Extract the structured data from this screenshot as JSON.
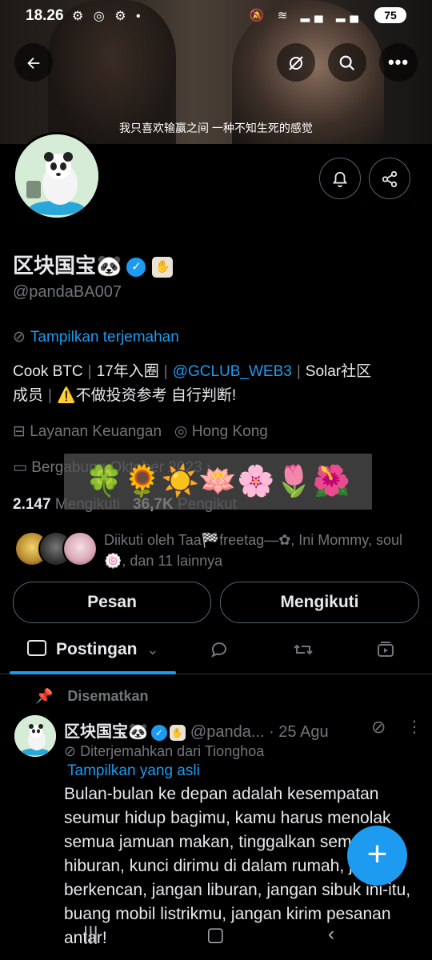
{
  "status_bar": {
    "time": "18.26",
    "left_icons": "⚙ ◎ ⚙ •",
    "right_icons": "🔕 ≋ ▂▄ ▂▄",
    "battery": "75"
  },
  "banner": {
    "subtitle": "我只喜欢输赢之间 一种不知生死的感觉"
  },
  "profile": {
    "name": "区块国宝🐼",
    "handle": "@pandaBA007",
    "translate_label": "Tampilkan terjemahan",
    "bio": {
      "part1": "Cook BTC",
      "part2": "17年入圈",
      "link": "@GCLUB_WEB3",
      "part3": "Solar社区",
      "part4": "成员",
      "part5": "⚠️不做投资参考 自行判断!"
    },
    "category": "Layanan Keuangan",
    "location": "Hong Kong",
    "joined": "Bergabung Oktober 2023",
    "emoji_overlay": "🍀🌻☀️🪷🌸🌷🌺",
    "following_count": "2.147",
    "following_label": "Mengikuti",
    "followers_count": "36,7K",
    "followers_label": "Pengikut",
    "followed_by": "Diikuti oleh Taa🏁freetag—✿, Ini Mommy, soul 🍥, dan 11 lainnya"
  },
  "buttons": {
    "message": "Pesan",
    "following": "Mengikuti"
  },
  "tabs": {
    "posts": "Postingan"
  },
  "post": {
    "pinned_label": "Disematkan",
    "name": "区块国宝🐼",
    "handle": "@panda...",
    "date": "· 25 Agu",
    "translated_from": "Diterjemahkan dari Tionghoa",
    "show_original": "Tampilkan yang asli",
    "text": "Bulan-bulan ke depan adalah kesempatan seumur hidup bagimu, kamu harus menolak semua jamuan makan, tinggalkan semua hiburan, kunci dirimu di dalam rumah, jangan berkencan, jangan liburan, jangan sibuk ini-itu, buang mobil listrikmu, jangan kirim pesanan antar!"
  },
  "colors": {
    "accent": "#1d9bf0",
    "muted": "#71767b",
    "text": "#e7e9ea",
    "background": "#000000"
  }
}
